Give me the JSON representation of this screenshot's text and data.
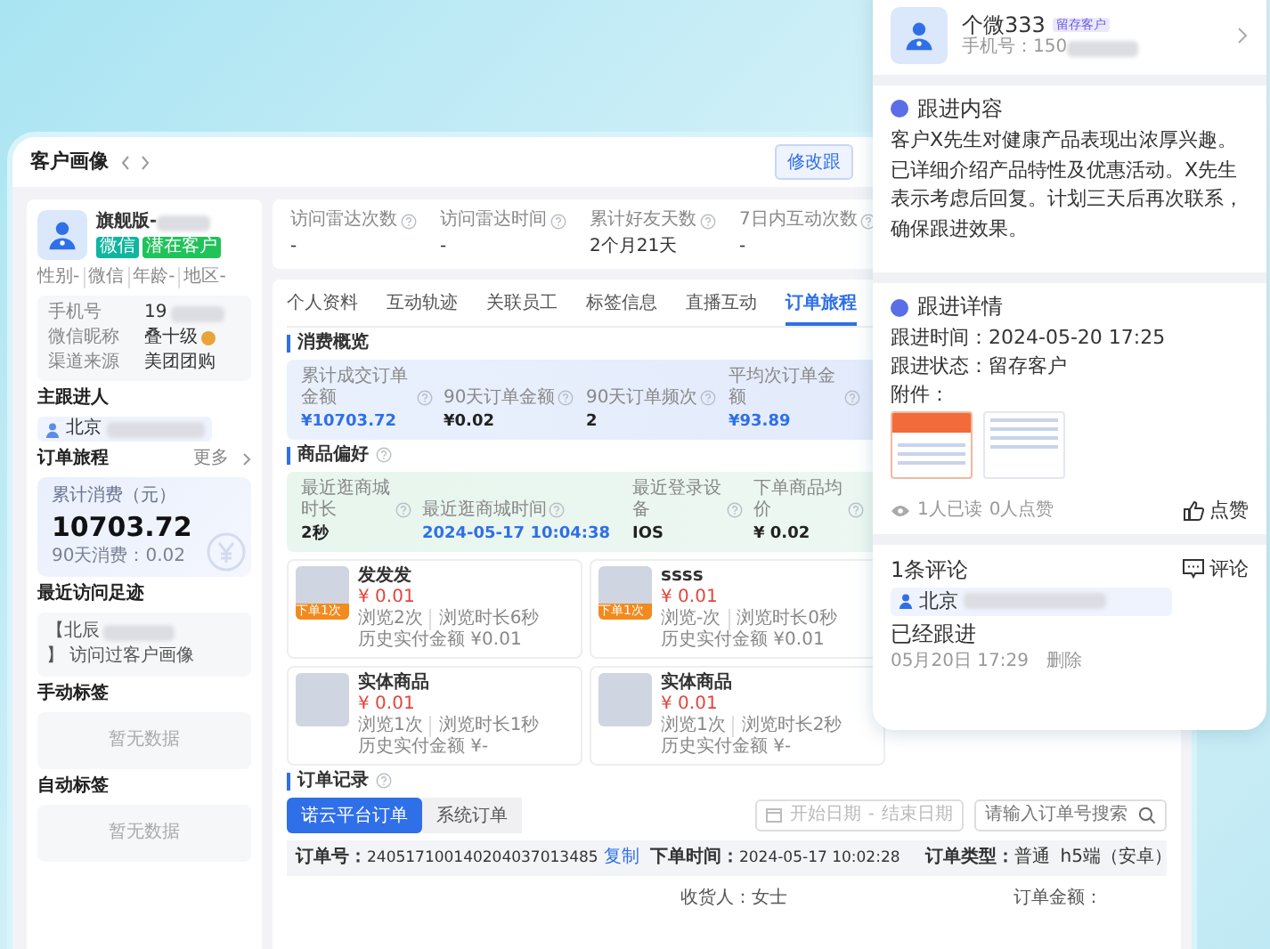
{
  "header": {
    "title": "客户画像",
    "edit_button": "修改跟"
  },
  "profile": {
    "name": "旗舰版-",
    "tags": [
      {
        "label": "微信",
        "color": "#10b5a0"
      },
      {
        "label": "潜在客户",
        "color": "#1fc35a"
      }
    ],
    "attributes": [
      "性别-",
      "微信",
      "年龄-",
      "地区-"
    ],
    "info": [
      {
        "label": "手机号",
        "value": "19",
        "blurred": true
      },
      {
        "label": "微信昵称",
        "value": "叠十级",
        "blurred": false
      },
      {
        "label": "渠道来源",
        "value": "美团团购",
        "blurred": false
      }
    ]
  },
  "owner": {
    "title": "主跟进人",
    "name": "北京"
  },
  "order_journey": {
    "title": "订单旅程",
    "more": "更多",
    "total_label": "累计消费（元）",
    "total": "10703.72",
    "recent": "90天消费：0.02"
  },
  "recent_visit": {
    "title": "最近访问足迹",
    "prefix": "【北辰",
    "suffix": "】 访问过客户画像"
  },
  "manual_tags": {
    "title": "手动标签",
    "empty": "暂无数据"
  },
  "auto_tags": {
    "title": "自动标签",
    "empty": "暂无数据"
  },
  "stats": [
    {
      "label": "访问雷达次数",
      "value": "-"
    },
    {
      "label": "访问雷达时间",
      "value": "-"
    },
    {
      "label": "累计好友天数",
      "value": "2个月21天"
    },
    {
      "label": "7日内互动次数",
      "value": "-"
    }
  ],
  "tabs": [
    {
      "label": "个人资料",
      "selected": false
    },
    {
      "label": "互动轨迹",
      "selected": false
    },
    {
      "label": "关联员工",
      "selected": false
    },
    {
      "label": "标签信息",
      "selected": false
    },
    {
      "label": "直播互动",
      "selected": false
    },
    {
      "label": "订单旅程",
      "selected": true
    }
  ],
  "consumption": {
    "title": "消费概览",
    "metrics": [
      {
        "label": "累计成交订单金额",
        "value": "¥10703.72",
        "highlight": true
      },
      {
        "label": "90天订单金额",
        "value": "¥0.02",
        "highlight": false
      },
      {
        "label": "90天订单频次",
        "value": "2",
        "highlight": false
      },
      {
        "label": "平均次订单金额",
        "value": "¥93.89",
        "highlight": true
      }
    ]
  },
  "preference": {
    "title": "商品偏好",
    "metrics": [
      {
        "label": "最近逛商城时长",
        "value": "2秒",
        "highlight": false
      },
      {
        "label": "最近逛商城时间",
        "value": "2024-05-17 10:04:38",
        "highlight": true
      },
      {
        "label": "最近登录设备",
        "value": "IOS",
        "highlight": false
      },
      {
        "label": "下单商品均价",
        "value": "¥ 0.02",
        "highlight": false
      }
    ]
  },
  "products": [
    {
      "name": "发发发",
      "price": "¥ 0.01",
      "badge": "下单1次",
      "views": "浏览2次",
      "duration": "浏览时长6秒",
      "paid": "历史实付金额 ¥0.01"
    },
    {
      "name": "ssss",
      "price": "¥ 0.01",
      "badge": "下单1次",
      "views": "浏览-次",
      "duration": "浏览时长0秒",
      "paid": "历史实付金额 ¥0.01"
    },
    {
      "name": "实体商品",
      "price": "¥ 0.01",
      "views": "浏览1次",
      "duration": "浏览时长1秒",
      "paid": "历史实付金额 ¥-"
    },
    {
      "name": "实体商品",
      "price": "¥ 0.01",
      "views": "浏览1次",
      "duration": "浏览时长2秒",
      "paid": "历史实付金额 ¥-"
    }
  ],
  "orders": {
    "title": "订单记录",
    "tabs": [
      {
        "label": "诺云平台订单",
        "selected": true
      },
      {
        "label": "系统订单",
        "selected": false
      }
    ],
    "date_start": "开始日期",
    "date_separator": "-",
    "date_end": "结束日期",
    "search_placeholder": "请输入订单号搜索",
    "order": {
      "number_label": "订单号：",
      "number": "240517100140204037013485",
      "copy": "复制",
      "time_label": "下单时间：",
      "time": "2024-05-17 10:02:28",
      "type_label": "订单类型：",
      "type": "普通",
      "channel": "h5端（安卓）",
      "receiver_label": "收货人：",
      "receiver": "女士",
      "amount_label": "订单金额："
    }
  },
  "follow_card": {
    "name": "个微333",
    "badge": "留存客户",
    "phone": "手机号：150",
    "content_title": "跟进内容",
    "content": "客户X先生对健康产品表现出浓厚兴趣。已详细介绍产品特性及优惠活动。X先生表示考虑后回复。计划三天后再次联系，确保跟进效果。",
    "detail_title": "跟进详情",
    "time": "跟进时间：2024-05-20 17:25",
    "status": "跟进状态：留存客户",
    "attachments_label": "附件：",
    "reads": "1人已读",
    "likes": "0人点赞",
    "like_button": "点赞",
    "comment_count": "1条评论",
    "comment_button": "评论",
    "comments": [
      {
        "author": "北京",
        "text": "已经跟进",
        "time": "05月20日 17:29",
        "delete": "删除"
      }
    ]
  }
}
